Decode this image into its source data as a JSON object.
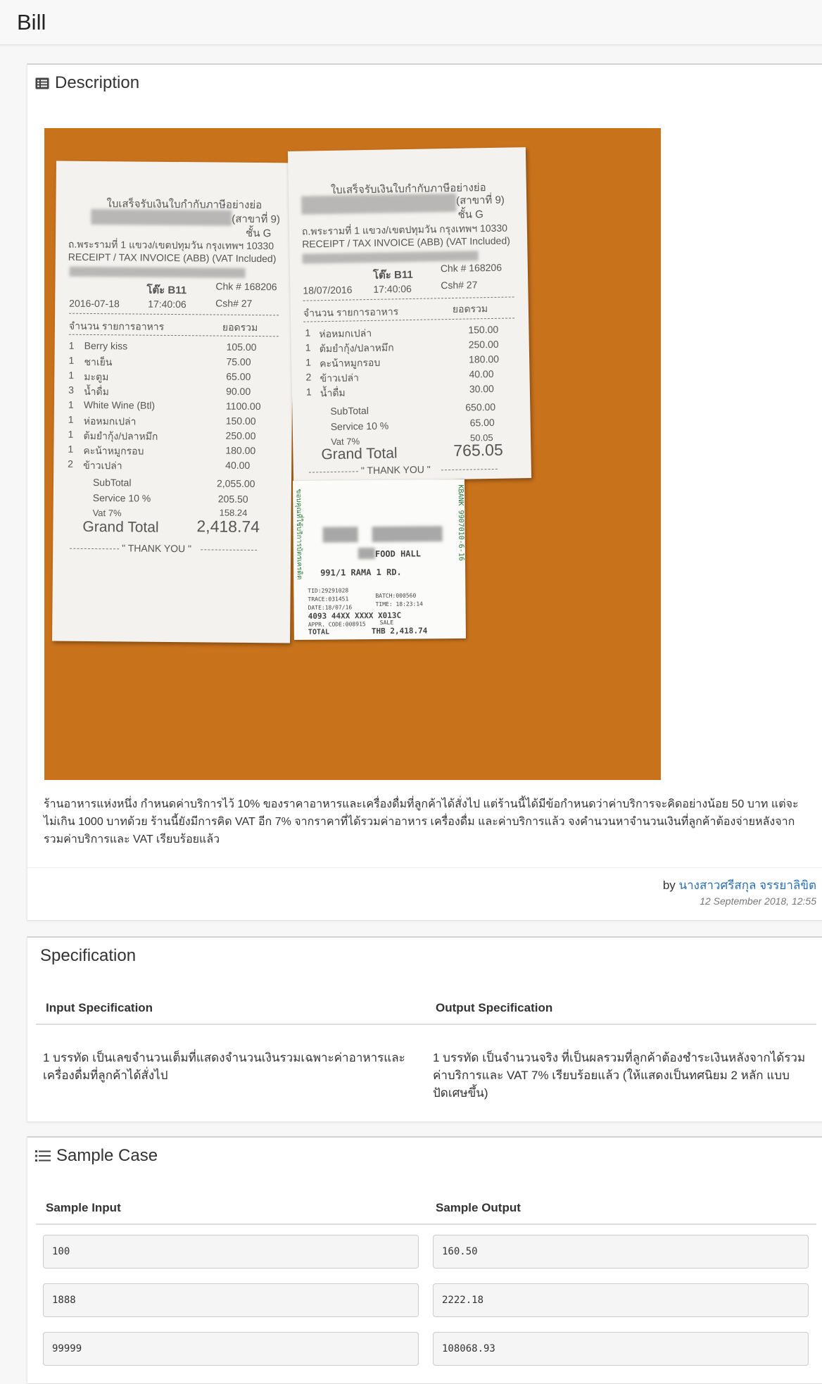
{
  "header": {
    "title": "Bill"
  },
  "description": {
    "heading": "Description",
    "text": "ร้านอาหารแห่งหนึ่ง กำหนดค่าบริการไว้ 10% ของราคาอาหารและเครื่องดื่มที่ลูกค้าได้สั่งไป แต่ร้านนี้ได้มีข้อกำหนดว่าค่าบริการจะคิดอย่างน้อย 50 บาท แต่จะไม่เกิน 1000 บาทด้วย ร้านนี้ยังมีการคิด VAT อีก 7% จากราคาที่ได้รวมค่าอาหาร เครื่องดื่ม และค่าบริการแล้ว จงคำนวนหาจำนวนเงินที่ลูกค้าต้องจ่ายหลังจากรวมค่าบริการและ VAT เรียบร้อยแล้ว",
    "by_prefix": "by",
    "author": "นางสาวศรีสกุล จรรยาลิขิต",
    "timestamp": "12 September 2018, 12:55"
  },
  "receipt_left": {
    "title": "ใบเสร็จรับเงินใบกำกับภาษีอย่างย่อ",
    "branch": "(สาขาที่ 9)",
    "floor": "ชั้น G",
    "address": "ถ.พระรามที่ 1 แขวง/เขตปทุมวัน กรุงเทพฯ 10330",
    "tax_line": "RECEIPT / TAX INVOICE (ABB)   (VAT Included)",
    "table": "โต๊ะ B11",
    "chk": "Chk #   168206",
    "date": "2016-07-18",
    "time": "17:40:06",
    "csh": "Csh#   27",
    "col_qty": "จำนวน   รายการอาหาร",
    "col_total": "ยอดรวม",
    "items": [
      {
        "qty": "1",
        "name": "Berry kiss",
        "price": "105.00"
      },
      {
        "qty": "1",
        "name": "ชาเย็น",
        "price": "75.00"
      },
      {
        "qty": "1",
        "name": "มะตูม",
        "price": "65.00"
      },
      {
        "qty": "3",
        "name": "น้ำดื่ม",
        "price": "90.00"
      },
      {
        "qty": "1",
        "name": "White Wine (Btl)",
        "price": "1100.00"
      },
      {
        "qty": "1",
        "name": "ห่อหมกเปล่า",
        "price": "150.00"
      },
      {
        "qty": "1",
        "name": "ต้มยำกุ้ง/ปลาหมึก",
        "price": "250.00"
      },
      {
        "qty": "1",
        "name": "คะน้าหมูกรอบ",
        "price": "180.00"
      },
      {
        "qty": "2",
        "name": "ข้าวเปล่า",
        "price": "40.00"
      }
    ],
    "subtotal_label": "SubTotal",
    "subtotal": "2,055.00",
    "service_label": "Service 10 %",
    "service": "205.50",
    "vat_label": "Vat 7%",
    "vat": "158.24",
    "grand_label": "Grand Total",
    "grand": "2,418.74",
    "thanks": "\" THANK YOU \""
  },
  "receipt_right": {
    "title": "ใบเสร็จรับเงินใบกำกับภาษีอย่างย่อ",
    "branch": "(สาขาที่ 9)",
    "floor": "ชั้น G",
    "address": "ถ.พระรามที่ 1 แขวง/เขตปทุมวัน กรุงเทพฯ 10330",
    "tax_line": "RECEIPT / TAX INVOICE (ABB)   (VAT Included)",
    "table": "โต๊ะ B11",
    "chk": "Chk #   168206",
    "date": "18/07/2016",
    "time": "17:40:06",
    "csh": "Csh#   27",
    "col_qty": "จำนวน   รายการอาหาร",
    "col_total": "ยอดรวม",
    "items": [
      {
        "qty": "1",
        "name": "ห่อหมกเปล่า",
        "price": "150.00"
      },
      {
        "qty": "1",
        "name": "ต้มยำกุ้ง/ปลาหมึก",
        "price": "250.00"
      },
      {
        "qty": "1",
        "name": "คะน้าหมูกรอบ",
        "price": "180.00"
      },
      {
        "qty": "2",
        "name": "ข้าวเปล่า",
        "price": "40.00"
      },
      {
        "qty": "1",
        "name": "น้ำดื่ม",
        "price": "30.00"
      }
    ],
    "subtotal_label": "SubTotal",
    "subtotal": "650.00",
    "service_label": "Service 10 %",
    "service": "65.00",
    "vat_label": "Vat 7%",
    "vat": "50.05",
    "grand_label": "Grand Total",
    "grand": "765.05",
    "thanks": "\" THANK YOU \""
  },
  "card_slip": {
    "side_left": "ขอบคุณที่ใช้บริการบัตรเครดิต",
    "side_right": "KBANK 9907010-6-16",
    "merchant": "FOOD HALL",
    "address": "991/1 RAMA 1 RD.",
    "tid": "TID:29291028",
    "batch": "BATCH:000560",
    "trace": "TRACE:031451",
    "time": "TIME: 18:23:14",
    "date": "DATE:18/07/16",
    "card": "4093 44XX  XXXX  X013C",
    "appr": "APPR. CODE:008915",
    "sale": "SALE",
    "total_label": "TOTAL",
    "total": "THB 2,418.74"
  },
  "specification": {
    "heading": "Specification",
    "input_head": "Input Specification",
    "output_head": "Output Specification",
    "input_text": "1 บรรทัด เป็นเลขจำนวนเต็มที่แสดงจำนวนเงินรวมเฉพาะค่าอาหารและเครื่องดื่มที่ลูกค้าได้สั่งไป",
    "output_text": "1 บรรทัด เป็นจำนวนจริง ที่เป็นผลรวมที่ลูกค้าต้องชำระเงินหลังจากได้รวมค่าบริการและ VAT 7% เรียบร้อยแล้ว (ให้แสดงเป็นทศนิยม 2 หลัก แบบปัดเศษขึ้น)"
  },
  "sample": {
    "heading": "Sample Case",
    "input_head": "Sample Input",
    "output_head": "Sample Output",
    "cases": [
      {
        "input": "100",
        "output": "160.50"
      },
      {
        "input": "1888",
        "output": "2222.18"
      },
      {
        "input": "99999",
        "output": "108068.93"
      }
    ]
  }
}
